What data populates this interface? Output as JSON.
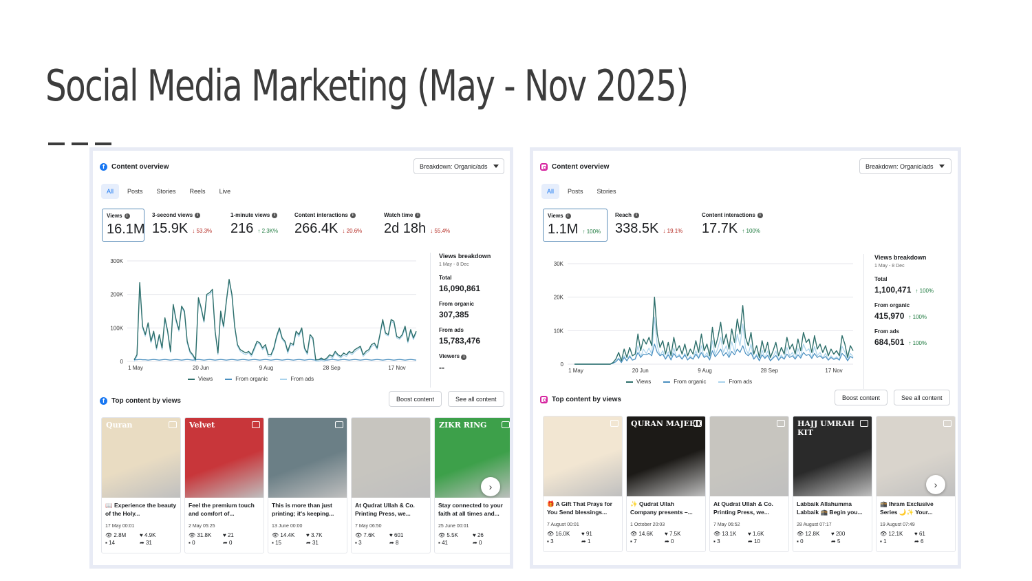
{
  "slide": {
    "title": "Social Media Marketing  (May - Nov 2025)"
  },
  "facebook": {
    "header": "Content overview",
    "breakdown": "Breakdown: Organic/ads",
    "tabs": [
      "All",
      "Posts",
      "Stories",
      "Reels",
      "Live"
    ],
    "metrics": [
      {
        "label": "Views",
        "value": "16.1M",
        "delta": ""
      },
      {
        "label": "3-second views",
        "value": "15.9K",
        "delta": "↓ 53.3%",
        "dir": "down"
      },
      {
        "label": "1-minute views",
        "value": "216",
        "delta": "↑ 2.3K%",
        "dir": "up"
      },
      {
        "label": "Content interactions",
        "value": "266.4K",
        "delta": "↓ 20.6%",
        "dir": "down"
      },
      {
        "label": "Watch time",
        "value": "2d 18h",
        "delta": "↓ 55.4%",
        "dir": "down"
      }
    ],
    "breakdown_panel": {
      "title": "Views breakdown",
      "range": "1 May - 8 Dec",
      "rows": [
        {
          "label": "Total",
          "value": "16,090,861"
        },
        {
          "label": "From organic",
          "value": "307,385"
        },
        {
          "label": "From ads",
          "value": "15,783,476"
        },
        {
          "label": "Viewers",
          "value": "--"
        }
      ]
    },
    "top_header": "Top content by views",
    "boost_label": "Boost content",
    "see_all_label": "See all content",
    "posts": [
      {
        "caption": "📖 Experience the beauty of the Holy...",
        "date": "17 May 00:01",
        "views": "2.8M",
        "likes": "4.9K",
        "comments": "14",
        "shares": "31",
        "thumb_text": "Quran",
        "bg": "#e9dcc2"
      },
      {
        "caption": "Feel the premium touch and comfort of...",
        "date": "2 May 05:25",
        "views": "31.8K",
        "likes": "21",
        "comments": "0",
        "shares": "0",
        "thumb_text": "Velvet",
        "bg": "#c8363a"
      },
      {
        "caption": "This is more than just printing; it's keeping...",
        "date": "13 June 00:00",
        "views": "14.4K",
        "likes": "3.7K",
        "comments": "15",
        "shares": "31",
        "thumb_text": "",
        "bg": "#6b7f86"
      },
      {
        "caption": "At Qudrat Ullah & Co. Printing Press, we...",
        "date": "7 May 06:50",
        "views": "7.6K",
        "likes": "601",
        "comments": "3",
        "shares": "8",
        "thumb_text": "",
        "bg": "#c7c5bf"
      },
      {
        "caption": "Stay connected to your faith at all times and...",
        "date": "25 June 00:01",
        "views": "5.5K",
        "likes": "26",
        "comments": "41",
        "shares": "0",
        "thumb_text": "ZIKR RING",
        "bg": "#3da04a"
      }
    ],
    "chart_data": {
      "type": "line",
      "x_ticks": [
        "1 May",
        "20 Jun",
        "9 Aug",
        "28 Sep",
        "17 Nov"
      ],
      "y_ticks": [
        "300K",
        "200K",
        "100K",
        "0"
      ],
      "ylim": [
        0,
        300000
      ],
      "series": [
        {
          "name": "Views",
          "values": [
            5000,
            20000,
            235000,
            105000,
            80000,
            115000,
            60000,
            90000,
            40000,
            80000,
            40000,
            130000,
            90000,
            30000,
            170000,
            125000,
            95000,
            165000,
            150000,
            60000,
            30000,
            20000,
            5000,
            190000,
            160000,
            120000,
            200000,
            205000,
            215000,
            90000,
            25000,
            150000,
            105000,
            180000,
            245000,
            200000,
            105000,
            50000,
            35000,
            30000,
            25000,
            30000,
            20000,
            40000,
            60000,
            55000,
            40000,
            50000,
            20000,
            20000,
            40000,
            75000,
            100000,
            70000,
            60000,
            30000,
            55000,
            50000,
            90000,
            80000,
            100000,
            40000,
            25000,
            80000,
            70000,
            5000,
            5000,
            10000,
            5000,
            10000,
            20000,
            15000,
            30000,
            20000,
            15000,
            25000,
            20000,
            30000,
            25000,
            35000,
            40000,
            45000,
            20000,
            30000,
            35000,
            50000,
            55000,
            40000,
            80000,
            125000,
            85000,
            80000,
            125000,
            120000,
            75000,
            70000,
            80000,
            105000,
            60000,
            95000,
            70000,
            90000
          ]
        },
        {
          "name": "From organic",
          "values": [
            5000,
            5000,
            6000,
            5000,
            5000,
            4000,
            5000,
            6000,
            5000,
            4000,
            5000,
            6000,
            5000,
            4000,
            5000,
            6000,
            5000,
            4000,
            5000,
            6000,
            5000,
            4000,
            5000,
            6000,
            5000,
            4000,
            5000,
            6000,
            5000,
            4000,
            5000,
            6000,
            5000,
            4000,
            5000,
            6000,
            5000,
            4000,
            5000,
            6000,
            5000,
            4000,
            5000,
            6000,
            5000,
            4000,
            5000,
            6000,
            5000,
            4000,
            5000,
            6000,
            5000,
            4000,
            5000,
            6000,
            5000,
            4000,
            5000,
            6000,
            5000,
            4000,
            5000,
            6000,
            5000,
            4000,
            5000,
            6000,
            5000,
            4000,
            5000,
            6000,
            5000,
            4000,
            5000,
            6000,
            5000,
            4000,
            5000,
            6000,
            5000,
            4000,
            5000,
            6000,
            5000,
            4000,
            5000,
            6000,
            5000,
            4000,
            5000,
            6000,
            5000,
            4000,
            5000,
            6000,
            5000,
            4000,
            5000,
            6000,
            5000,
            4000
          ]
        },
        {
          "name": "From ads",
          "values": [
            0,
            15000,
            229000,
            100000,
            75000,
            111000,
            55000,
            84000,
            35000,
            76000,
            35000,
            124000,
            85000,
            26000,
            165000,
            119000,
            90000,
            161000,
            145000,
            54000,
            25000,
            16000,
            0,
            184000,
            155000,
            116000,
            195000,
            199000,
            210000,
            86000,
            20000,
            144000,
            100000,
            176000,
            240000,
            194000,
            100000,
            46000,
            30000,
            24000,
            20000,
            26000,
            15000,
            34000,
            55000,
            51000,
            35000,
            44000,
            15000,
            16000,
            35000,
            69000,
            95000,
            66000,
            55000,
            24000,
            50000,
            46000,
            85000,
            74000,
            95000,
            36000,
            20000,
            74000,
            65000,
            1000,
            0,
            4000,
            0,
            6000,
            15000,
            9000,
            25000,
            16000,
            10000,
            19000,
            15000,
            26000,
            20000,
            29000,
            35000,
            41000,
            15000,
            24000,
            30000,
            44000,
            50000,
            36000,
            75000,
            119000,
            80000,
            76000,
            120000,
            114000,
            70000,
            66000,
            75000,
            99000,
            55000,
            89000,
            65000,
            86000
          ]
        }
      ],
      "colors": {
        "views": "#2c6e6a",
        "organic": "#4a8fbf",
        "ads": "#a9d3ec"
      }
    }
  },
  "instagram": {
    "header": "Content overview",
    "breakdown": "Breakdown: Organic/ads",
    "tabs": [
      "All",
      "Posts",
      "Stories"
    ],
    "metrics": [
      {
        "label": "Views",
        "value": "1.1M",
        "delta": "↑ 100%",
        "dir": "up"
      },
      {
        "label": "Reach",
        "value": "338.5K",
        "delta": "↓ 19.1%",
        "dir": "down"
      },
      {
        "label": "Content interactions",
        "value": "17.7K",
        "delta": "↑ 100%",
        "dir": "up"
      }
    ],
    "breakdown_panel": {
      "title": "Views breakdown",
      "range": "1 May - 8 Dec",
      "rows": [
        {
          "label": "Total",
          "value": "1,100,471",
          "delta": "↑ 100%"
        },
        {
          "label": "From organic",
          "value": "415,970",
          "delta": "↑ 100%"
        },
        {
          "label": "From ads",
          "value": "684,501",
          "delta": "↑ 100%"
        }
      ]
    },
    "top_header": "Top content by views",
    "boost_label": "Boost content",
    "see_all_label": "See all content",
    "posts": [
      {
        "caption": "🎁 A Gift That Prays for You Send blessings...",
        "date": "7 August 00:01",
        "views": "16.0K",
        "likes": "91",
        "comments": "3",
        "shares": "1",
        "thumb_text": "",
        "bg": "#f2e6d2"
      },
      {
        "caption": "✨ Qudrat Ullah Company presents –...",
        "date": "1 October 20:03",
        "views": "14.6K",
        "likes": "7.5K",
        "comments": "7",
        "shares": "0",
        "thumb_text": "QURAN MAJEED",
        "bg": "#1c1a17"
      },
      {
        "caption": "At Qudrat Ullah & Co. Printing Press, we...",
        "date": "7 May 06:52",
        "views": "13.1K",
        "likes": "1.6K",
        "comments": "3",
        "shares": "10",
        "thumb_text": "",
        "bg": "#c7c5bf"
      },
      {
        "caption": "Labbaik Allahumma Labbaik 🕋 Begin you...",
        "date": "28 August 07:17",
        "views": "12.8K",
        "likes": "200",
        "comments": "0",
        "shares": "5",
        "thumb_text": "HAJJ UMRAH KIT",
        "bg": "#2a2a2a"
      },
      {
        "caption": "🕋 Ihram Exclusive Series 🌙✨ Your...",
        "date": "19 August 07:49",
        "views": "12.1K",
        "likes": "61",
        "comments": "1",
        "shares": "6",
        "thumb_text": "",
        "bg": "#d9d4cc"
      }
    ],
    "chart_data": {
      "type": "line",
      "x_ticks": [
        "1 May",
        "20 Jun",
        "9 Aug",
        "28 Sep",
        "17 Nov"
      ],
      "y_ticks": [
        "30K",
        "20K",
        "10K",
        "0"
      ],
      "ylim": [
        0,
        30000
      ],
      "series": [
        {
          "name": "Views",
          "values": [
            0,
            0,
            0,
            0,
            0,
            0,
            0,
            0,
            0,
            0,
            0,
            0,
            0,
            0,
            500,
            1500,
            3500,
            1000,
            4500,
            2000,
            5000,
            2500,
            3000,
            9000,
            4000,
            7500,
            6000,
            8000,
            5500,
            20000,
            9000,
            5000,
            7000,
            3000,
            6500,
            2500,
            8000,
            4000,
            5500,
            3000,
            6000,
            2500,
            4500,
            3000,
            7000,
            3500,
            9000,
            4000,
            6000,
            2500,
            11000,
            5000,
            8000,
            12500,
            6000,
            9000,
            4500,
            10500,
            6500,
            13500,
            9000,
            17500,
            8000,
            5500,
            9500,
            3000,
            5500,
            2000,
            7000,
            3500,
            6500,
            2000,
            4000,
            6500,
            2500,
            5000,
            3000,
            8000,
            4500,
            6000,
            3000,
            7500,
            4000,
            9500,
            6500,
            7500,
            3500,
            8500,
            4500,
            6000,
            3500,
            5500,
            2500,
            4500,
            3000,
            4000,
            2500,
            8500,
            6000,
            2000,
            5500,
            4000
          ]
        },
        {
          "name": "From organic",
          "values": [
            0,
            0,
            0,
            0,
            0,
            0,
            0,
            0,
            0,
            0,
            0,
            0,
            0,
            0,
            300,
            700,
            1600,
            500,
            2000,
            1000,
            2300,
            1200,
            1500,
            3500,
            2000,
            3000,
            2800,
            3200,
            2500,
            6000,
            3500,
            2500,
            3000,
            1500,
            2800,
            1300,
            3200,
            2000,
            2500,
            1500,
            2800,
            1300,
            2000,
            1500,
            3000,
            1800,
            3500,
            2000,
            2500,
            1300,
            4000,
            2200,
            3200,
            4500,
            2500,
            3500,
            2000,
            3800,
            2800,
            4500,
            3500,
            5500,
            3200,
            2500,
            3500,
            1500,
            2500,
            1000,
            2800,
            1700,
            2600,
            1000,
            1800,
            2600,
            1200,
            2200,
            1500,
            3000,
            2000,
            2500,
            1500,
            2800,
            1800,
            3500,
            2600,
            2900,
            1700,
            3200,
            2000,
            2500,
            1700,
            2300,
            1200,
            2000,
            1400,
            1800,
            1200,
            3200,
            2400,
            1000,
            2300,
            1800
          ]
        },
        {
          "name": "From ads",
          "values": [
            0,
            0,
            0,
            0,
            0,
            0,
            0,
            0,
            0,
            0,
            0,
            0,
            0,
            0,
            200,
            800,
            1900,
            500,
            2500,
            1000,
            2700,
            1300,
            1500,
            5500,
            2000,
            4500,
            3200,
            4800,
            3000,
            14000,
            5500,
            2500,
            4000,
            1500,
            3700,
            1200,
            4800,
            2000,
            3000,
            1500,
            3200,
            1200,
            2500,
            1500,
            4000,
            1700,
            5500,
            2000,
            3500,
            1200,
            7000,
            2800,
            4800,
            8000,
            3500,
            5500,
            2500,
            6700,
            3700,
            9000,
            5500,
            12000,
            4800,
            3000,
            6000,
            1500,
            3000,
            1000,
            4200,
            1800,
            3900,
            1000,
            2200,
            3900,
            1300,
            2800,
            1500,
            5000,
            2500,
            3500,
            1500,
            4700,
            2200,
            6000,
            3900,
            4600,
            1800,
            5300,
            2500,
            3500,
            1800,
            3200,
            1300,
            2500,
            1600,
            2200,
            1300,
            5300,
            3600,
            1000,
            3200,
            2200
          ]
        }
      ],
      "colors": {
        "views": "#2c6e6a",
        "organic": "#4a8fbf",
        "ads": "#a9d3ec"
      }
    }
  }
}
